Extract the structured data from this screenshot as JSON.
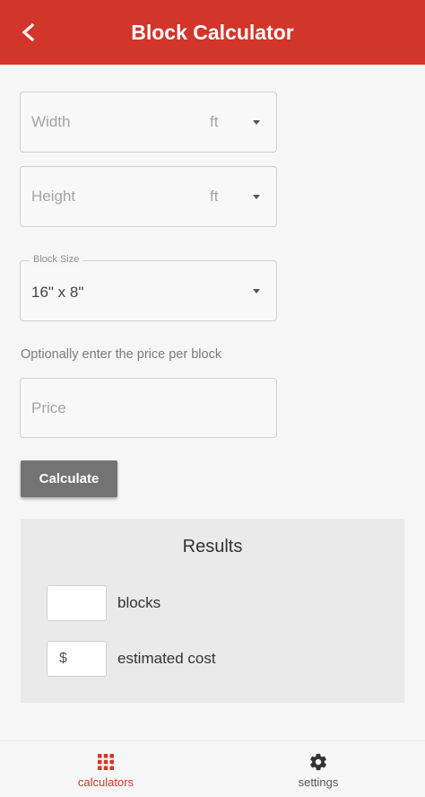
{
  "app_bar": {
    "title": "Block Calculator",
    "back_icon": "arrow-back-icon",
    "color": "#d2352a"
  },
  "form": {
    "width": {
      "placeholder": "Width",
      "unit": "ft"
    },
    "height": {
      "placeholder": "Height",
      "unit": "ft"
    },
    "block_size": {
      "label": "Block Size",
      "value": "16\" x 8\""
    },
    "price_hint": "Optionally enter the price per block",
    "price": {
      "placeholder": "Price"
    },
    "calculate_label": "Calculate"
  },
  "results": {
    "title": "Results",
    "blocks_value": "",
    "blocks_label": "blocks",
    "cost_prefix": "$",
    "cost_label": "estimated cost"
  },
  "bottom_nav": {
    "items": [
      {
        "label": "calculators",
        "icon": "grid-icon",
        "active": true,
        "color": "#d2352a"
      },
      {
        "label": "settings",
        "icon": "gear-icon",
        "active": false,
        "color": "#555555"
      }
    ]
  }
}
